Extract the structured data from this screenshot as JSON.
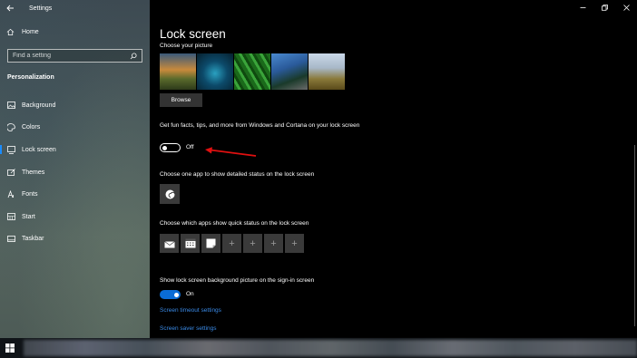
{
  "window": {
    "app_title": "Settings",
    "back_icon": "arrow-left-icon",
    "controls": [
      "minimize-icon",
      "restore-icon",
      "close-icon"
    ]
  },
  "sidebar": {
    "home_label": "Home",
    "search_placeholder": "Find a setting",
    "section_label": "Personalization",
    "items": [
      {
        "label": "Background",
        "icon": "picture-icon"
      },
      {
        "label": "Colors",
        "icon": "palette-icon"
      },
      {
        "label": "Lock screen",
        "icon": "lock-screen-icon",
        "active": true
      },
      {
        "label": "Themes",
        "icon": "brush-icon"
      },
      {
        "label": "Fonts",
        "icon": "font-icon"
      },
      {
        "label": "Start",
        "icon": "start-grid-icon"
      },
      {
        "label": "Taskbar",
        "icon": "taskbar-icon"
      }
    ]
  },
  "main": {
    "title": "Lock screen",
    "choose_picture_label": "Choose your picture",
    "browse_label": "Browse",
    "fun_facts_text": "Get fun facts, tips, and more from Windows and Cortana on your lock screen",
    "fun_facts_toggle_label": "Off",
    "fun_facts_toggle_on": false,
    "detailed_status_label": "Choose one app to show detailed status on the lock screen",
    "detailed_status_app_icon": "weather-icon",
    "quick_status_label": "Choose which apps show quick status on the lock screen",
    "quick_status_apps": [
      "mail-icon",
      "calendar-icon",
      "sticky-notes-icon",
      "plus-icon",
      "plus-icon",
      "plus-icon",
      "plus-icon"
    ],
    "quick_status_plus": "+",
    "show_bg_label": "Show lock screen background picture on the sign-in screen",
    "show_bg_toggle_label": "On",
    "show_bg_toggle_on": true,
    "link_timeout": "Screen timeout settings",
    "link_saver": "Screen saver settings"
  },
  "colors": {
    "accent": "#0a6cd6",
    "link": "#3a8ae6",
    "annotation_arrow": "#e01010"
  }
}
